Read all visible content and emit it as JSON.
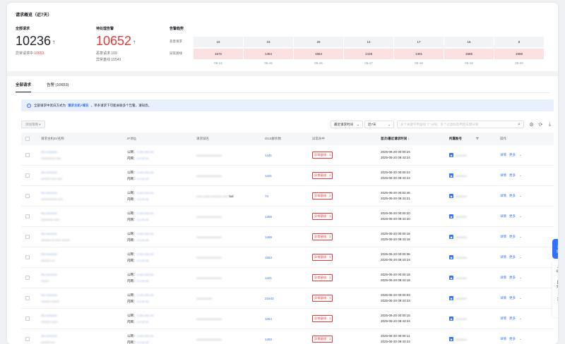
{
  "overview": {
    "title": "请求概览（近7天）",
    "total": {
      "label": "全部请求",
      "value": "10236",
      "arrow": "↑",
      "sub_label": "异常请求中",
      "sub_value": "10653"
    },
    "alarm": {
      "label": "待处理告警",
      "value": "10652",
      "arrow": "↑",
      "line1": "恶意请求 109",
      "line2": "异常基线 10543"
    },
    "trend": {
      "title": "告警趋势",
      "row1_label": "恶意请求",
      "row2_label": "异常基线",
      "row1": [
        "16",
        "15",
        "26",
        "12",
        "17",
        "16",
        "8"
      ],
      "row2": [
        "1572",
        "1464",
        "1554",
        "1419",
        "1401",
        "1565",
        "1568"
      ],
      "dates": [
        "05-14",
        "05-15",
        "05-16",
        "05-17",
        "05-18",
        "05-19",
        "05-20"
      ]
    }
  },
  "tabs": [
    {
      "label": "全部请求"
    },
    {
      "label": "告警 (10653)"
    }
  ],
  "banner": {
    "prefix": "全部请求中黑白方式为",
    "link": "请求主机+域名",
    "suffix": "，单条请求下可能关联多个告警，请知悉。",
    "icon": "info-icon"
  },
  "toolbar": {
    "add_label": "添加策略",
    "add_arrow": "▾",
    "sort_select": "最近请求时间",
    "range_select": "近7天",
    "caret": "⌄",
    "search_placeholder": "多个关键字用竖线 \"|\" 分隔，多个过滤标签用回车键分隔",
    "search_icon": "⌕",
    "settings_icon": "⚙",
    "refresh_icon": "⟳",
    "download_icon": "⤓"
  },
  "table": {
    "headers": [
      "请求主机ID/名称",
      "IP地址",
      "请求域名",
      "DNS解析数",
      "异常命中",
      "首次/最近请求时间",
      "所属账号",
      "操作"
    ],
    "sort_arrow": "↓",
    "filter_icon": "⛛",
    "ip_public_label": "公网：",
    "ip_private_label": "内网：",
    "detail_label": "详情",
    "more_label": "更多",
    "tag_label": "异常基线：1",
    "rows": [
      {
        "host": "ins-xxxxxxx",
        "name": "xxxxxxxxx-xxx",
        "pub": "x.xxx.xxx.xx",
        "pri": "x.x.xx.xx",
        "domain": "xxxxxxxxxxxxxxxx",
        "domain_extra": "",
        "dns": "1441",
        "first": "2025-05-20 00:00:24",
        "last": "2025-05-20 09:43:24",
        "account": "xxxxxxx"
      },
      {
        "host": "ins-xxxxxxx",
        "name": "xxxxxx-xxx-xxx",
        "pub": "x.xxx.xxx.xx",
        "pri": "x.x.xx.xx",
        "domain": "xxxxxxxxxxxxxxxx",
        "domain_extra": "",
        "dns": "1421",
        "first": "2025-05-20 00:00:24",
        "last": "2025-05-20 09:43:24",
        "account": "xxxxxxx"
      },
      {
        "host": "ins-xxxxxxx",
        "name": "xxxxxxxxxx-xxx",
        "pub": "x.xxx.xxx.xx",
        "pri": "x.x.xx.xx",
        "domain": "xxxx.xxxx.xxxxxxx.xxxx",
        "domain_extra": "bal",
        "dns": "74",
        "first": "2025-05-20 00:02:46",
        "last": "2025-05-20 09:43:21",
        "account": "xxxxxxx"
      },
      {
        "host": "ins-xxxxxxx",
        "name": "xxxxxxxx-xxx",
        "pub": "x.xxx.xxx.xx",
        "pri": "x.x.xx.xx",
        "domain": "xxxxxxxxxxxxxxxx",
        "domain_extra": "",
        "dns": "1456",
        "first": "2025-05-20 00:00:20",
        "last": "2025-05-20 09:43:20",
        "account": "xxxxxxx"
      },
      {
        "host": "ins-xxxxxxx",
        "name": "xxxxxx-xx-xxx-xxxxx",
        "pub": "x.xxx.xxx.xx",
        "pri": "x.x.xx.xx",
        "domain": "xxxxxxxxxxxxxxxx",
        "domain_extra": "",
        "dns": "1469",
        "first": "2025-05-20 00:00:18",
        "last": "2025-05-20 09:43:18",
        "account": "xxxxxxx"
      },
      {
        "host": "ins-xxxxxxx",
        "name": "xxxxxx-xx",
        "pub": "x.xxx.xxx.xx",
        "pri": "x.x.xx.xx",
        "domain": "xxxxxxxxxxxxxxxx",
        "domain_extra": "",
        "dns": "1553",
        "first": "2025-05-20 00:00:36",
        "last": "2025-05-20 09:43:24",
        "account": "xxxxxxx"
      },
      {
        "host": "ins-xxxxxxx",
        "name": "xxxxx",
        "pub": "x.xxx.xxx.xx",
        "pri": "x.x.xx.xx",
        "domain": "xxxxxxxxxxxxxxxx",
        "domain_extra": "",
        "dns": "1421",
        "first": "2025-05-20 00:00:18",
        "last": "2025-05-20 09:43:18",
        "account": "xxxxxxx"
      },
      {
        "host": "ins-xxxxxxx",
        "name": "xxxxxx-xxxxx",
        "pub": "x.xxx.xxx.xx",
        "pri": "x.x.xx.xx",
        "domain": "xxxxxxxxxx",
        "domain_extra": "",
        "dns": "21643",
        "first": "2025-05-20 00:00:03",
        "last": "2025-05-20 09:43:23",
        "account": "xxxxxxx"
      },
      {
        "host": "ins-xxxxxxx",
        "name": "xxxxxx-xxxx",
        "pub": "x.xxx.xxx.xx",
        "pri": "x.x.xx.xx",
        "domain": "xxxxxxxxxxxxxxxx",
        "domain_extra": "",
        "dns": "1264",
        "first": "2025-05-20 00:00:15",
        "last": "2025-05-20 09:43:24",
        "account": "xxxxxxx"
      },
      {
        "host": "ins-xxxxxxx",
        "name": "xxxxxx-xx",
        "pub": "x.xxx.xxx.xx",
        "pri": "x.x.xx.xx",
        "domain": "xxxxxxxxxxxxxxxx",
        "domain_extra": "",
        "dns": "1493",
        "first": "2025-05-20 00:00:11",
        "last": "2025-05-20 09:43:24",
        "account": "xxxxxxx"
      }
    ]
  },
  "sidebar": {
    "consult_label": "咨询",
    "dynamic_label": "动态",
    "docs_label": "文档",
    "consult_icon": "headset-icon",
    "dynamic_icon": "cloud-icon",
    "docs_icon": "book-icon",
    "menu_icon": "list-icon"
  },
  "colors": {
    "accent": "#3370ff",
    "danger": "#e03a3a",
    "baseline_bg": "#fbe1e1"
  }
}
